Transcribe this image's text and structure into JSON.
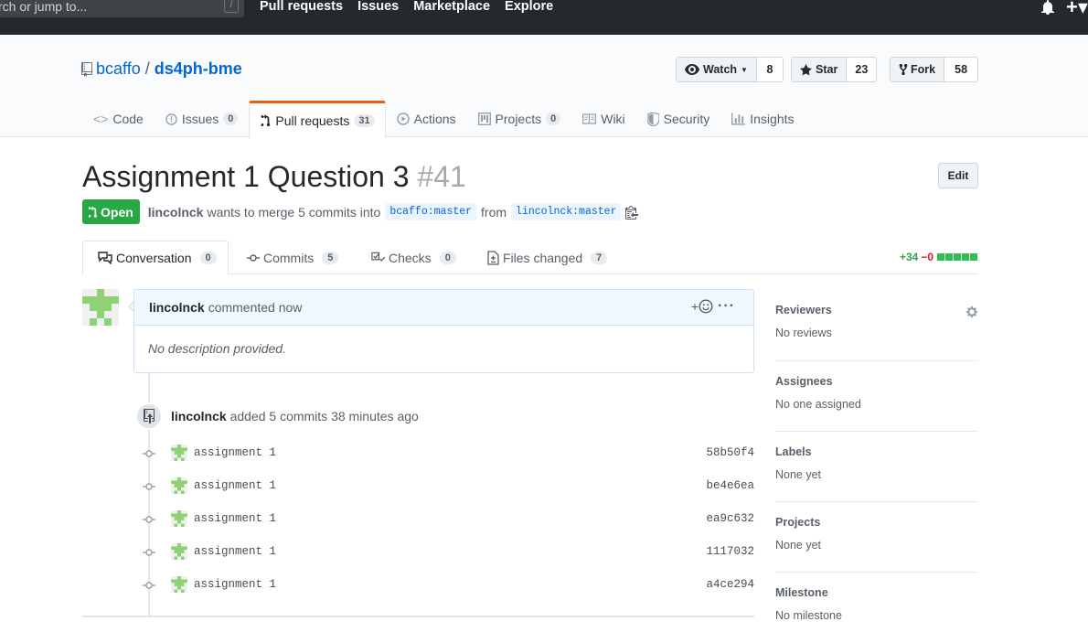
{
  "header": {
    "search_placeholder": "rch or jump to...",
    "search_hotkey": "/",
    "nav": [
      "Pull requests",
      "Issues",
      "Marketplace",
      "Explore"
    ]
  },
  "repo": {
    "owner": "bcaffo",
    "separator": "/",
    "name": "ds4ph-bme",
    "watch_label": "Watch",
    "watch_count": "8",
    "star_label": "Star",
    "star_count": "23",
    "fork_label": "Fork",
    "fork_count": "58"
  },
  "reponav": [
    {
      "label": "Code",
      "count": null,
      "icon": "code-icon"
    },
    {
      "label": "Issues",
      "count": "0",
      "icon": "issue-icon"
    },
    {
      "label": "Pull requests",
      "count": "31",
      "icon": "pull-request-icon"
    },
    {
      "label": "Actions",
      "count": null,
      "icon": "actions-icon"
    },
    {
      "label": "Projects",
      "count": "0",
      "icon": "project-icon"
    },
    {
      "label": "Wiki",
      "count": null,
      "icon": "wiki-icon"
    },
    {
      "label": "Security",
      "count": null,
      "icon": "shield-icon"
    },
    {
      "label": "Insights",
      "count": null,
      "icon": "graph-icon"
    }
  ],
  "pr": {
    "title": "Assignment 1 Question 3",
    "number": "#41",
    "edit_label": "Edit",
    "state": "Open",
    "author": "lincolnck",
    "merge_text": "wants to merge 5 commits into",
    "base_branch": "bcaffo:master",
    "from_text": "from",
    "head_branch": "lincolnck:master"
  },
  "prtabs": [
    {
      "label": "Conversation",
      "count": "0"
    },
    {
      "label": "Commits",
      "count": "5"
    },
    {
      "label": "Checks",
      "count": "0"
    },
    {
      "label": "Files changed",
      "count": "7"
    }
  ],
  "diffstat": {
    "additions": "+34",
    "deletions": "−0"
  },
  "comment": {
    "author": "lincolnck",
    "action": "commented now",
    "reaction_label": "+",
    "more_label": "···",
    "body": "No description provided."
  },
  "push": {
    "author": "lincolnck",
    "text": "added 5 commits 38 minutes ago"
  },
  "commits": [
    {
      "message": "assignment 1",
      "sha": "58b50f4"
    },
    {
      "message": "assignment 1",
      "sha": "be4e6ea"
    },
    {
      "message": "assignment 1",
      "sha": "ea9c632"
    },
    {
      "message": "assignment 1",
      "sha": "1117032"
    },
    {
      "message": "assignment 1",
      "sha": "a4ce294"
    }
  ],
  "sidebar": [
    {
      "heading": "Reviewers",
      "value": "No reviews"
    },
    {
      "heading": "Assignees",
      "value": "No one assigned"
    },
    {
      "heading": "Labels",
      "value": "None yet"
    },
    {
      "heading": "Projects",
      "value": "None yet"
    },
    {
      "heading": "Milestone",
      "value": "No milestone"
    }
  ],
  "colors": {
    "header_bg": "#24292e",
    "link": "#0366d6",
    "open_green": "#28a745",
    "tab_accent": "#e36209",
    "avatar_green": "#8fd175"
  }
}
